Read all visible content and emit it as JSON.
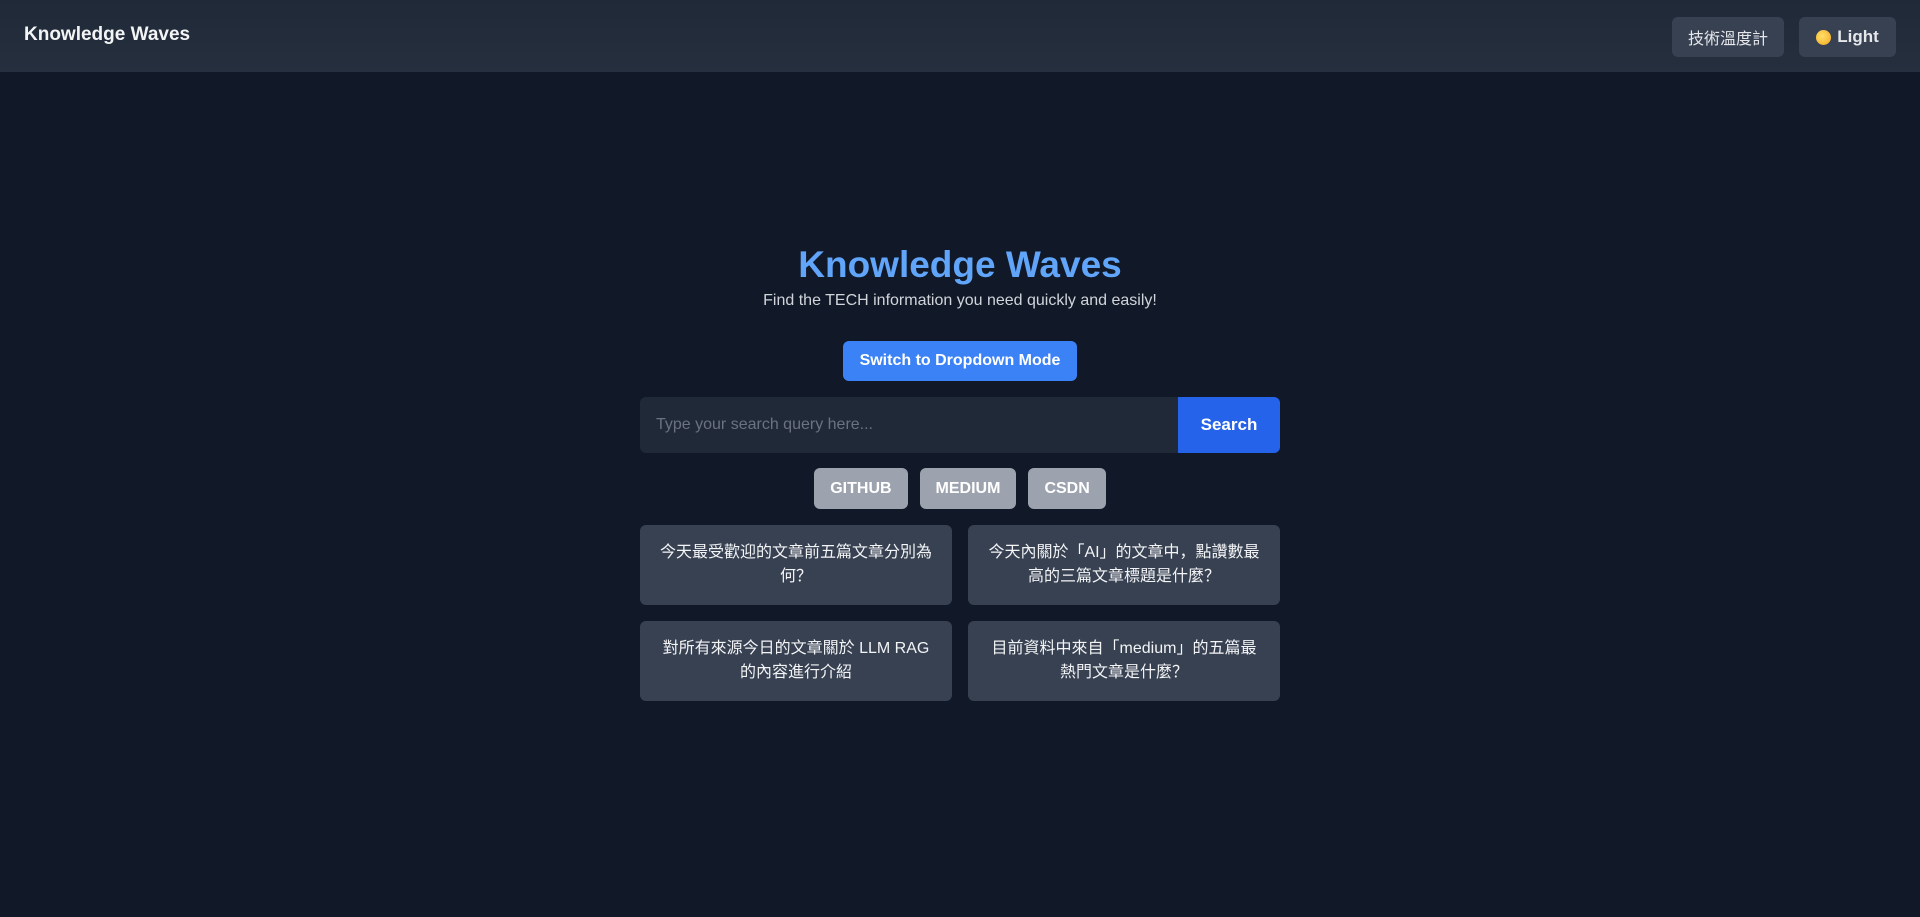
{
  "navbar": {
    "brand": "Knowledge Waves",
    "tracker_label": "技術溫度計",
    "theme_label": "Light",
    "theme_icon": "sun-face-icon"
  },
  "hero": {
    "title": "Knowledge Waves",
    "subtitle": "Find the TECH information you need quickly and easily!"
  },
  "mode_toggle": {
    "label": "Switch to Dropdown Mode"
  },
  "search": {
    "placeholder": "Type your search query here...",
    "value": "",
    "button_label": "Search"
  },
  "sources": [
    "GITHUB",
    "MEDIUM",
    "CSDN"
  ],
  "suggestions": [
    "今天最受歡迎的文章前五篇文章分別為何？",
    "今天內關於「AI」的文章中，點讚數最高的三篇文章標題是什麼？",
    "對所有來源今日的文章關於 LLM RAG 的內容進行介紹",
    "目前資料中來自「medium」的五篇最熱門文章是什麼？"
  ],
  "colors": {
    "background": "#111827",
    "navbar": "#1f2937",
    "accent": "#3b82f6",
    "title": "#60a5fa",
    "tag": "#9ca3af",
    "card": "#374151"
  }
}
